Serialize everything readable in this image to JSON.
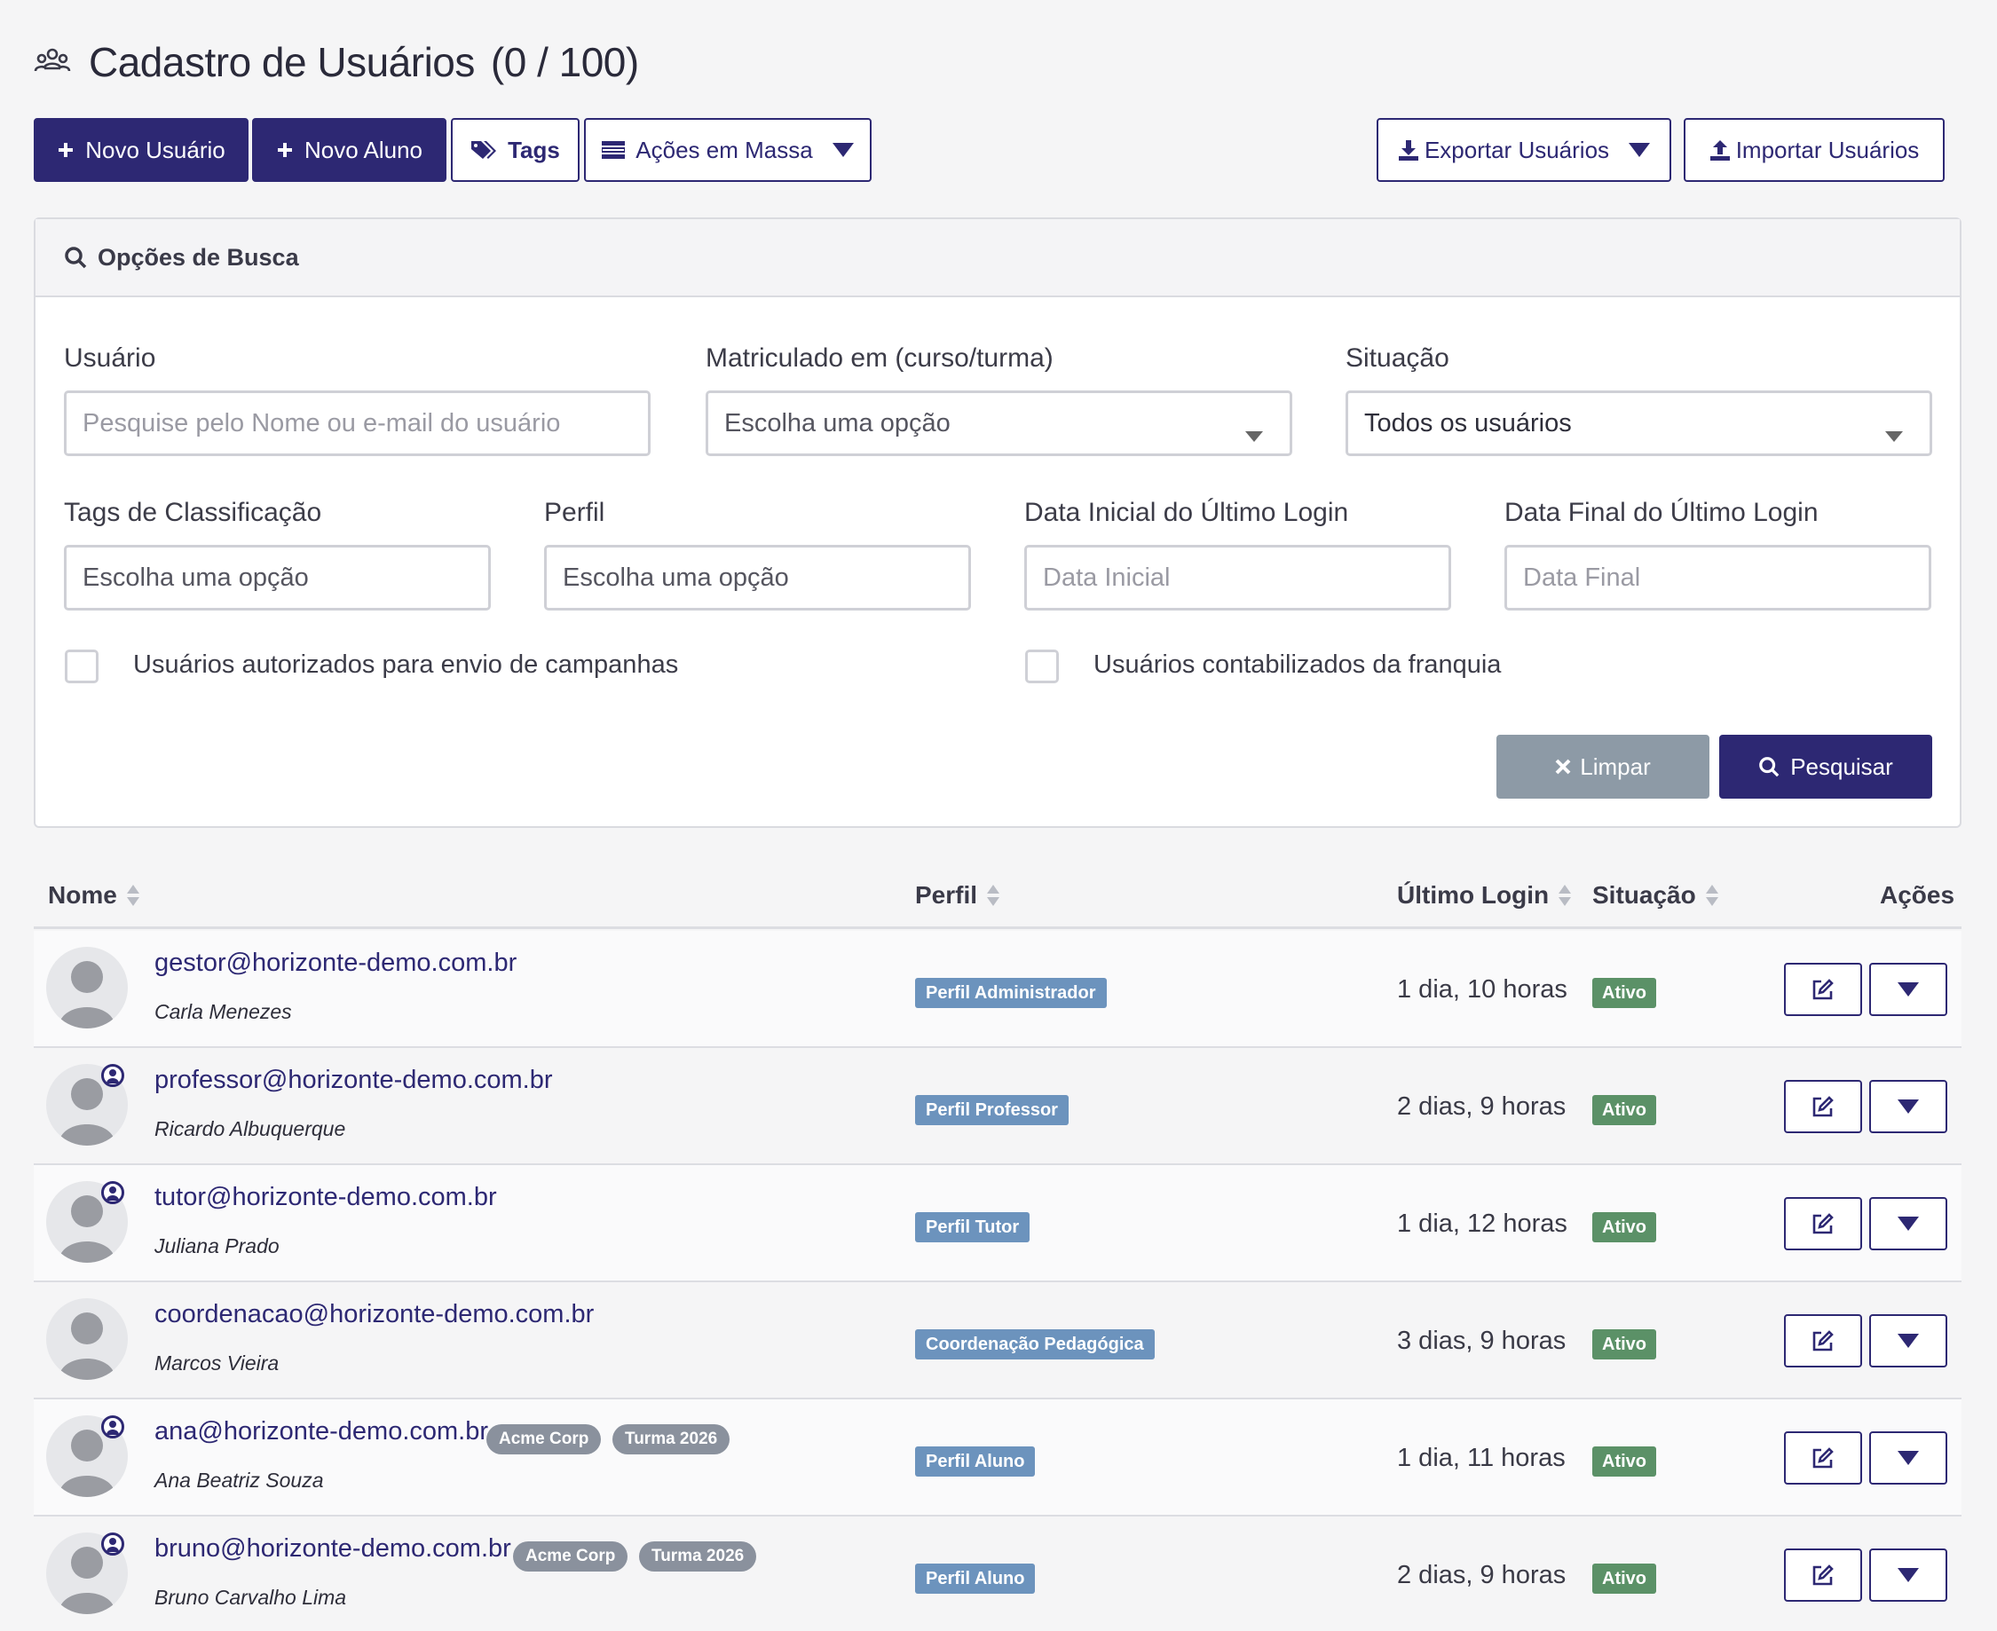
{
  "header": {
    "title": "Cadastro de Usuários",
    "count": "(0 /  100)",
    "icon": "users-group-icon"
  },
  "toolbar": {
    "new_user": "Novo Usuário",
    "new_student": "Novo Aluno",
    "tags": "Tags",
    "bulk_actions": "Ações em Massa",
    "export": "Exportar Usuários",
    "import": "Importar Usuários"
  },
  "search": {
    "heading": "Opções de Busca",
    "user_label": "Usuário",
    "user_placeholder": "Pesquise pelo Nome ou e-mail do usuário",
    "enrolled_label": "Matriculado em (curso/turma)",
    "enrolled_value": "Escolha uma opção",
    "status_label": "Situação",
    "status_value": "Todos os usuários",
    "tags_label": "Tags de Classificação",
    "tags_value": "Escolha uma opção",
    "profile_label": "Perfil",
    "profile_value": "Escolha uma opção",
    "start_date_label": "Data Inicial do Último Login",
    "start_date_placeholder": "Data Inicial",
    "end_date_label": "Data Final do Último Login",
    "end_date_placeholder": "Data Final",
    "campaign_checkbox": "Usuários autorizados para envio de campanhas",
    "franchise_checkbox": "Usuários contabilizados da franquia",
    "clear": "Limpar",
    "search": "Pesquisar"
  },
  "table": {
    "columns": {
      "name": "Nome",
      "profile": "Perfil",
      "last_login": "Último Login",
      "status": "Situação",
      "actions": "Ações"
    },
    "rows": [
      {
        "email": "gestor@horizonte-demo.com.br",
        "name": "Carla Menezes",
        "tags": [],
        "profile": "Perfil Administrador",
        "last_login": "1 dia, 10 horas",
        "status": "Ativo",
        "badge": false
      },
      {
        "email": "professor@horizonte-demo.com.br",
        "name": "Ricardo Albuquerque",
        "tags": [],
        "profile": "Perfil Professor",
        "last_login": "2 dias, 9 horas",
        "status": "Ativo",
        "badge": true
      },
      {
        "email": "tutor@horizonte-demo.com.br",
        "name": "Juliana Prado",
        "tags": [],
        "profile": "Perfil Tutor",
        "last_login": "1 dia, 12 horas",
        "status": "Ativo",
        "badge": true
      },
      {
        "email": "coordenacao@horizonte-demo.com.br",
        "name": "Marcos Vieira",
        "tags": [],
        "profile": "Coordenação Pedagógica",
        "last_login": "3 dias, 9 horas",
        "status": "Ativo",
        "badge": false
      },
      {
        "email": "ana@horizonte-demo.com.br",
        "name": "Ana Beatriz Souza",
        "tags": [
          "Acme Corp",
          "Turma 2026"
        ],
        "profile": "Perfil Aluno",
        "last_login": "1 dia, 11 horas",
        "status": "Ativo",
        "badge": true
      },
      {
        "email": "bruno@horizonte-demo.com.br",
        "name": "Bruno Carvalho Lima",
        "tags": [
          "Acme Corp",
          "Turma 2026"
        ],
        "profile": "Perfil Aluno",
        "last_login": "2 dias, 9 horas",
        "status": "Ativo",
        "badge": true
      }
    ]
  },
  "colors": {
    "primary": "#2d2873",
    "profile_badge": "#6c93bd",
    "status_active": "#5b9167",
    "tag_gray": "#8a919d",
    "clear_button": "#8d9aa6"
  }
}
